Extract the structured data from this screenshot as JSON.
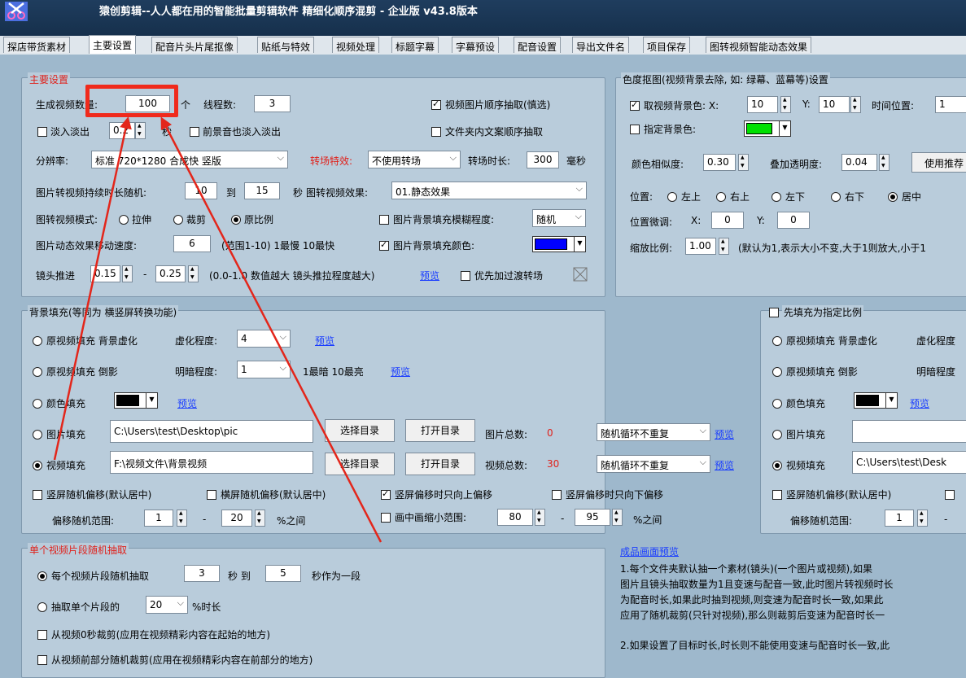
{
  "app": {
    "title": "猿创剪辑--人人都在用的智能批量剪辑软件    精细化顺序混剪 - 企业版  v43.8版本"
  },
  "tabs": [
    "探店带货素材",
    "主要设置",
    "配音片头片尾抠像",
    "贴纸与特效",
    "视频处理",
    "标题字幕",
    "字幕预设",
    "配音设置",
    "导出文件名",
    "项目保存",
    "图转视频智能动态效果"
  ],
  "main": {
    "title": "主要设置",
    "gen_label": "生成视频数量:",
    "gen_value": "100",
    "gen_unit": "个",
    "threads_label": "线程数:",
    "threads_value": "3",
    "seq_extract": "视频图片顺序抽取(慎选)",
    "fade": "淡入淡出",
    "fade_value": "0.2",
    "fade_unit": "秒",
    "bgm_fade": "前景音也淡入淡出",
    "folder_seq": "文件夹内文案顺序抽取",
    "res_label": "分辨率:",
    "res_value": "标准 720*1280 合成快 竖版",
    "trans_label": "转场特效:",
    "trans_value": "不使用转场",
    "trans_dur_label": "转场时长:",
    "trans_dur": "300",
    "trans_unit": "毫秒",
    "img_dur_label": "图片转视频持续时长随机:",
    "img_dur_from": "10",
    "img_dur_to_label": "到",
    "img_dur_to": "15",
    "img_dur_unit": "秒",
    "img_effect_label": "图转视频效果:",
    "img_effect": "01.静态效果",
    "mode_label": "图转视频模式:",
    "mode_stretch": "拉伸",
    "mode_crop": "裁剪",
    "mode_orig": "原比例",
    "blur_label": "图片背景填充模糊程度:",
    "blur_value": "随机",
    "speed_label": "图片动态效果移动速度:",
    "speed_value": "6",
    "speed_hint": "(范围1-10) 1最慢 10最快",
    "fill_color": "图片背景填充颜色:",
    "push_label": "镜头推进",
    "push_min": "0.15",
    "push_dash": "-",
    "push_max": "0.25",
    "push_hint": "(0.0-1.0 数值越大 镜头推拉程度越大)",
    "preview": "预览",
    "prefer_trans": "优先加过渡转场"
  },
  "chroma": {
    "title": "色度抠图(视频背景去除, 如: 绿幕、蓝幕等)设置",
    "take_bg": "取视频背景色: X:",
    "x": "10",
    "y_label": "Y:",
    "y": "10",
    "time_label": "时间位置:",
    "time": "1",
    "assign_bg": "指定背景色:",
    "sim_label": "颜色相似度:",
    "sim": "0.30",
    "alpha_label": "叠加透明度:",
    "alpha": "0.04",
    "recommend": "使用推荐",
    "pos_label": "位置:",
    "pos": [
      "左上",
      "右上",
      "左下",
      "右下",
      "居中"
    ],
    "fine_label": "位置微调:",
    "fx_label": "X:",
    "fx": "0",
    "fy_label": "Y:",
    "fy": "0",
    "scale_label": "缩放比例:",
    "scale": "1.00",
    "scale_hint": "(默认为1,表示大小不变,大于1则放大,小于1"
  },
  "bgfill": {
    "title": "背景填充(等同为 横竖屏转换功能)",
    "blur_opt": "原视频填充 背景虚化",
    "blur_label": "虚化程度:",
    "blur_value": "4",
    "mirror_opt": "原视频填充 倒影",
    "bright_label": "明暗程度:",
    "bright_value": "1",
    "bright_hint": "1最暗 10最亮",
    "color_opt": "颜色填充",
    "img_opt": "图片填充",
    "img_path": "C:\\Users\\test\\Desktop\\pic",
    "choose": "选择目录",
    "open": "打开目录",
    "img_count_label": "图片总数:",
    "img_count": "0",
    "loop": "随机循环不重复",
    "vid_opt": "视频填充",
    "vid_path": "F:\\视频文件\\背景视频",
    "vid_count_label": "视频总数:",
    "vid_count": "30",
    "v_off": "竖屏随机偏移(默认居中)",
    "h_off": "横屏随机偏移(默认居中)",
    "up_only": "竖屏偏移时只向上偏移",
    "down_only": "竖屏偏移时只向下偏移",
    "off_range": "偏移随机范围:",
    "off_min": "1",
    "off_max": "20",
    "off_unit": "%之间",
    "shrink": "画中画缩小范围:",
    "shrink_min": "80",
    "shrink_max": "95",
    "shrink_unit": "%之间"
  },
  "right_fill": {
    "title": "先填充为指定比例",
    "blur_opt": "原视频填充 背景虚化",
    "blur_label": "虚化程度",
    "mirror_opt": "原视频填充 倒影",
    "bright_label": "明暗程度",
    "color_opt": "颜色填充",
    "preview": "预览",
    "img_opt": "图片填充",
    "vid_opt": "视频填充",
    "vid_path": "C:\\Users\\test\\Desk",
    "v_off": "竖屏随机偏移(默认居中)",
    "off_range": "偏移随机范围:",
    "off_min": "1",
    "dash": "-"
  },
  "segment": {
    "title": "单个视频片段随机抽取",
    "each": "每个视频片段随机抽取",
    "from": "3",
    "sec_to": "秒 到",
    "to": "5",
    "tail": "秒作为一段",
    "pct_label": "抽取单个片段的",
    "pct": "20",
    "pct_tail": "%时长",
    "from0": "从视频0秒裁剪(应用在视频精彩内容在起始的地方)",
    "front": "从视频前部分随机裁剪(应用在视频精彩内容在前部分的地方)"
  },
  "preview_text": {
    "title": "成品画面预览",
    "p1": [
      "1.每个文件夹默认抽一个素材(镜头)(一个图片或视频),如果",
      "图片且镜头抽取数量为1且变速与配音一致,此时图片转视频时长",
      "为配音时长,如果此时抽到视频,则变速为配音时长一致,如果此",
      "应用了随机裁剪(只针对视频),那么则裁剪后变速为配音时长一"
    ],
    "p2": "2.如果设置了目标时长,时长则不能使用变速与配音时长一致,此"
  },
  "colors": {
    "accent_red": "#e0211b",
    "link": "#1a3dff",
    "green": "#00e000",
    "blue": "#0000ff"
  }
}
